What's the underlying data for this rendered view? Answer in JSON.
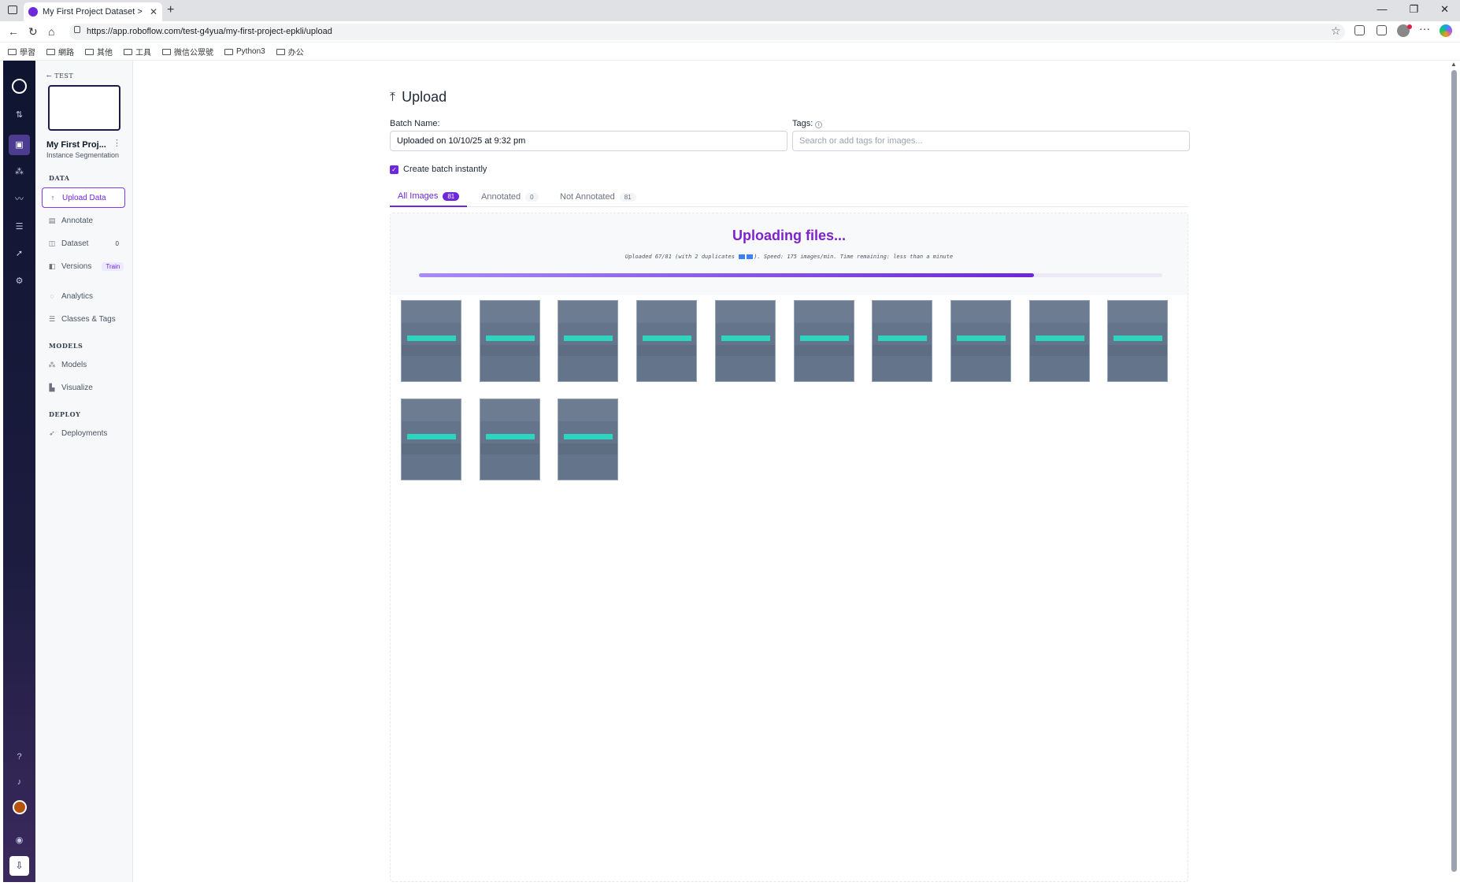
{
  "browser": {
    "tab_title": "My First Project Dataset > Upload",
    "url": "https://app.roboflow.com/test-g4yua/my-first-project-epkli/upload",
    "bookmarks": [
      "學習",
      "網路",
      "其他",
      "工具",
      "微信公眾號",
      "Python3",
      "办公"
    ]
  },
  "sidebar": {
    "back_label": "TEST",
    "project_name": "My First Proj...",
    "project_type": "Instance Segmentation",
    "sections": {
      "data": "DATA",
      "models": "MODELS",
      "deploy": "DEPLOY"
    },
    "items": {
      "upload": "Upload Data",
      "annotate": "Annotate",
      "dataset": "Dataset",
      "dataset_count": "0",
      "versions": "Versions",
      "versions_badge": "Train",
      "analytics": "Analytics",
      "classes": "Classes & Tags",
      "models": "Models",
      "visualize": "Visualize",
      "deployments": "Deployments"
    }
  },
  "page": {
    "title": "Upload",
    "batch_label": "Batch Name:",
    "batch_value": "Uploaded on 10/10/25 at 9:32 pm",
    "tags_label": "Tags:",
    "tags_placeholder": "Search or add tags for images...",
    "create_batch_label": "Create batch instantly",
    "tabs": [
      {
        "label": "All Images",
        "count": "81"
      },
      {
        "label": "Annotated",
        "count": "0"
      },
      {
        "label": "Not Annotated",
        "count": "81"
      }
    ],
    "upload_status": {
      "heading": "Uploading files...",
      "detail_prefix": "Uploaded 67/81 (with 2 duplicates",
      "detail_suffix": "). Speed: 175 images/min. Time remaining: less than a minute",
      "progress_fraction": 0.827
    },
    "thumbnail_count": 13
  },
  "colors": {
    "accent": "#6d28d9",
    "heading": "#7e22ce",
    "thumb": "#64748b",
    "thumb_band": "#2dd4bf"
  }
}
